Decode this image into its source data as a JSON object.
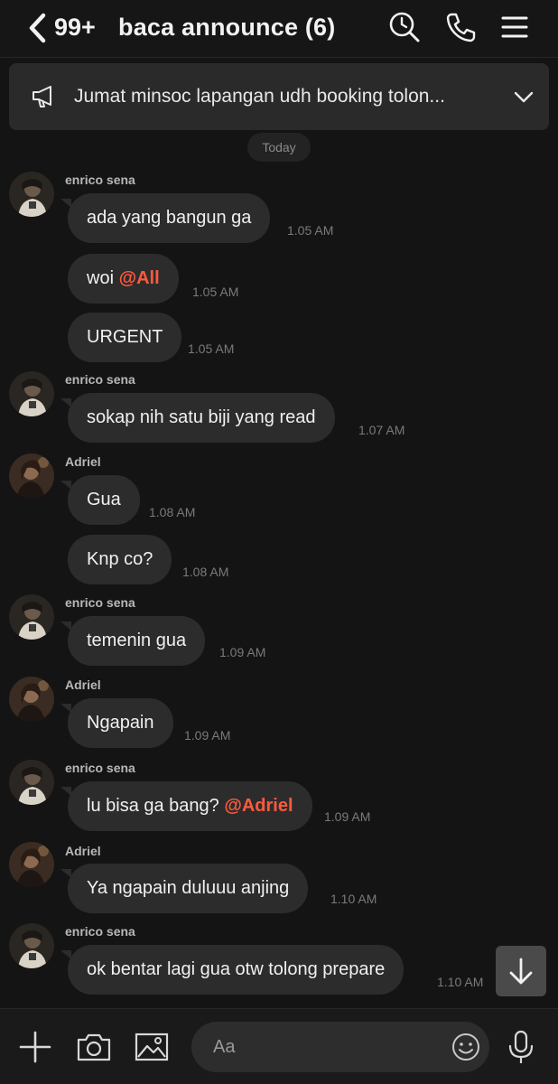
{
  "header": {
    "unread_count": "99+",
    "title": "baca announce (6)",
    "icons": [
      "back-chevron-icon",
      "search-clock-icon",
      "phone-icon",
      "menu-icon"
    ]
  },
  "announcement": {
    "text": "Jumat minsoc lapangan udh booking tolon..."
  },
  "date_divider": "Today",
  "messages": [
    {
      "sender": "enrico sena",
      "text": "ada yang bangun ga",
      "time": "1.05 AM"
    },
    {
      "text_prefix": "woi ",
      "mention": "@All",
      "time": "1.05 AM"
    },
    {
      "text": "URGENT",
      "time": "1.05 AM"
    },
    {
      "sender": "enrico sena",
      "text": "sokap nih satu biji yang read",
      "time": "1.07 AM"
    },
    {
      "sender": "Adriel",
      "text": "Gua",
      "time": "1.08 AM"
    },
    {
      "text": "Knp co?",
      "time": "1.08 AM"
    },
    {
      "sender": "enrico sena",
      "text": "temenin gua",
      "time": "1.09 AM"
    },
    {
      "sender": "Adriel",
      "text": "Ngapain",
      "time": "1.09 AM"
    },
    {
      "sender": "enrico sena",
      "text_prefix": "lu bisa ga bang? ",
      "mention": "@Adriel",
      "time": "1.09 AM"
    },
    {
      "sender": "Adriel",
      "text": "Ya ngapain duluuu anjing",
      "time": "1.10 AM"
    },
    {
      "sender": "enrico sena",
      "text": "ok bentar lagi gua otw tolong prepare",
      "time": "1.10 AM"
    }
  ],
  "composer": {
    "placeholder": "Aa",
    "icons": [
      "plus-icon",
      "camera-icon",
      "image-icon",
      "emoji-icon",
      "microphone-icon"
    ]
  },
  "colors": {
    "background": "#141414",
    "bubble": "#2c2c2c",
    "mention": "#ff5a3c",
    "header": "#161616"
  }
}
